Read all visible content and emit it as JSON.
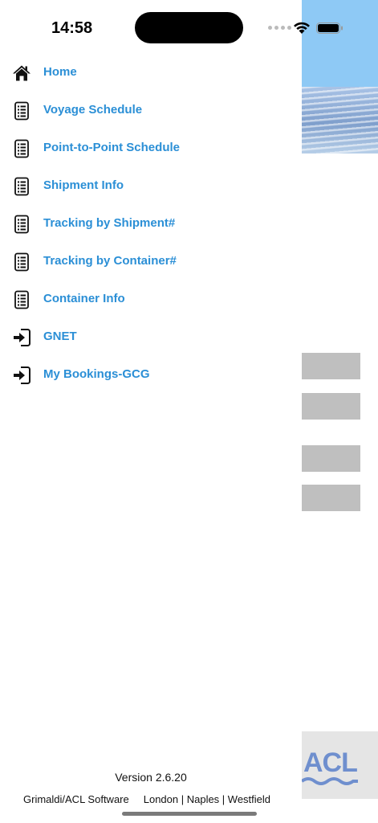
{
  "status_bar": {
    "time": "14:58"
  },
  "menu": [
    {
      "label": "Home",
      "icon": "home-icon"
    },
    {
      "label": "Voyage Schedule",
      "icon": "list-document-icon"
    },
    {
      "label": "Point-to-Point Schedule",
      "icon": "list-document-icon"
    },
    {
      "label": "Shipment Info",
      "icon": "list-document-icon"
    },
    {
      "label": "Tracking by Shipment#",
      "icon": "list-document-icon"
    },
    {
      "label": "Tracking by Container#",
      "icon": "list-document-icon"
    },
    {
      "label": "Container Info",
      "icon": "list-document-icon"
    },
    {
      "label": "GNET",
      "icon": "sign-in-icon"
    },
    {
      "label": "My Bookings-GCG",
      "icon": "sign-in-icon"
    }
  ],
  "footer": {
    "version": "Version 2.6.20",
    "company": "Grimaldi/ACL Software",
    "locations": "London | Naples | Westfield"
  },
  "background_app": {
    "logo_text": "ACL"
  },
  "colors": {
    "link": "#2b8fd6",
    "sky": "#8ec9f5",
    "button_gray": "#bfbfbf"
  }
}
